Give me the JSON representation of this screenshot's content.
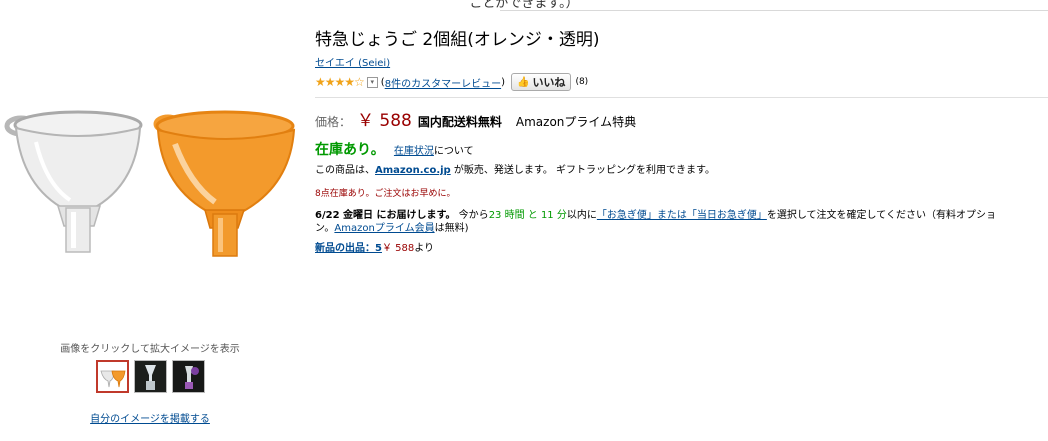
{
  "top_note": "ことができます。）",
  "product": {
    "title": "特急じょうご 2個組(オレンジ・透明)",
    "brand": "セイエイ (Seiei)",
    "rating_stars": "★★★★☆",
    "review_link": "8件のカスタマーレビュー",
    "like_label": "いいね",
    "like_count": "(8)"
  },
  "price": {
    "label": "価格：",
    "value": "￥ 588",
    "shipping": "国内配送料無料",
    "prime": "Amazonプライム特典"
  },
  "stock": {
    "status": "在庫あり。",
    "status_link": "在庫状況",
    "status_suffix": "について",
    "sold_by_prefix": "この商品は、",
    "sold_by_link": "Amazon.co.jp",
    "sold_by_suffix": " が販売、発送します。 ギフトラッピングを利用できます。",
    "remaining": "8点在庫あり。ご注文はお早めに。"
  },
  "delivery": {
    "date": "6/22 金曜日 にお届けします。",
    "lead": " 今から",
    "hours": "23 時間 と 11 分",
    "within": "以内に",
    "express_link": "「お急ぎ便」または「当日お急ぎ便」",
    "tail": "を選択して注文を確定してください（有料オプショ",
    "line2_prefix": "ン。",
    "prime_member_link": "Amazonプライム会員",
    "line2_suffix": "は無料)"
  },
  "offers": {
    "label": "新品の出品：5",
    "price": "￥ 588",
    "suffix": "より"
  },
  "gallery": {
    "caption": "画像をクリックして拡大イメージを表示",
    "post_link": "自分のイメージを掲載する"
  },
  "colors": {
    "link": "#004b91",
    "price": "#990000",
    "in_stock": "#009900",
    "orange_funnel": "#f39a2c"
  }
}
